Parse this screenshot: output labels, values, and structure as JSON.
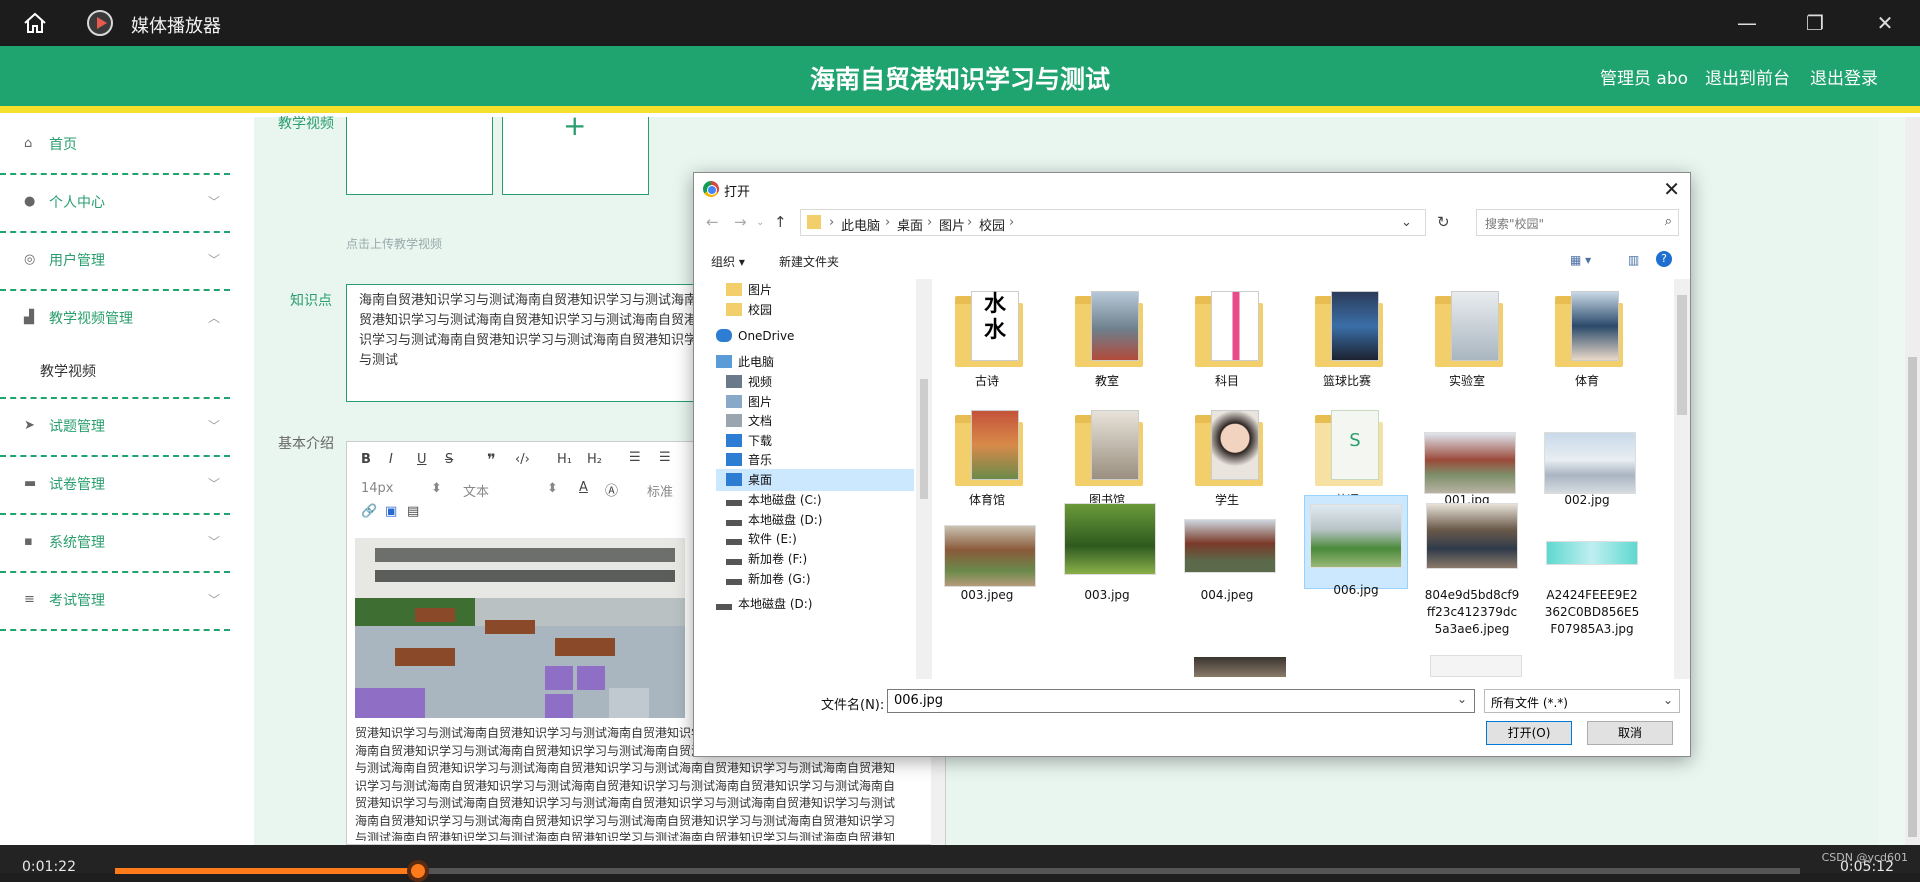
{
  "player": {
    "title": "媒体播放器",
    "time_current": "0:01:22",
    "time_total": "0:05:12",
    "progress": 0.18,
    "watermark": "CSDN @ycd601"
  },
  "site": {
    "title": "海南自贸港知识学习与测试",
    "admin": "管理员 abo",
    "front": "退出到前台",
    "logout": "退出登录"
  },
  "sidebar": {
    "items": [
      {
        "label": "首页",
        "icon": "home-icon"
      },
      {
        "label": "个人中心",
        "icon": "user-icon"
      },
      {
        "label": "用户管理",
        "icon": "settings-icon"
      },
      {
        "label": "教学视频管理",
        "icon": "chart-icon"
      },
      {
        "label": "试题管理",
        "icon": "send-icon"
      },
      {
        "label": "试卷管理",
        "icon": "monitor-icon"
      },
      {
        "label": "系统管理",
        "icon": "chat-icon"
      },
      {
        "label": "考试管理",
        "icon": "list-icon"
      }
    ],
    "sub": "教学视频"
  },
  "form": {
    "video_label": "教学视频",
    "upload_hint": "点击上传教学视频",
    "knowledge_label": "知识点",
    "knowledge_text": "海南自贸港知识学习与测试海南自贸港知识学习与测试海南自贸港知识学习与测试海南自贸港知识学习与测试海南自贸港知识学习与测试海南自贸港知识学习与测试海南自贸港知识学习与测试",
    "intro_label": "基本介绍",
    "font_size": "14px",
    "font_type": "文本",
    "heading": "标准",
    "editor_text": "贸港知识学习与测试海南自贸港知识学习与测试海南自贸港知识学习与测试海南自贸港知识学习与测试海南自贸港知识学习与测试海南自贸港知识学习与测试海南自贸港知识学习与测试海南自贸港知识学习与测试海南自贸港知识学习与测试海南自贸港知识学习与测试海南自贸港知识学习与测试海南自贸港知识学习与测试海南自贸港知识学习与测试海南自贸港知识学习与测试海南自贸港知识学习与测试海南自贸港知识学习与测试海南自贸港知识学习与测试海南自贸港知识学习与测试海南自贸港知识学习与测试海南自贸港知识学习与测试海南自贸港知识学习与测试海南自贸港知识学习与测试海南自贸港知识学习与测试海南自贸港知识学习与测试海南自贸港知识学习与测试海南自贸港知识学习与测试海南自贸港知识学习与测试"
  },
  "dialog": {
    "title": "打开",
    "path": [
      "此电脑",
      "桌面",
      "图片",
      "校园"
    ],
    "search_placeholder": "搜索\"校园\"",
    "organize": "组织 ▾",
    "new_folder": "新建文件夹",
    "tree": [
      "图片",
      "校园",
      "OneDrive",
      "此电脑",
      "视频",
      "图片",
      "文档",
      "下载",
      "音乐",
      "桌面",
      "本地磁盘 (C:)",
      "本地磁盘 (D:)",
      "软件 (E:)",
      "新加卷 (F:)",
      "新加卷 (G:)",
      "本地磁盘 (D:)"
    ],
    "files": [
      "古诗",
      "教室",
      "科目",
      "篮球比赛",
      "实验室",
      "体育",
      "体育馆",
      "图书馆",
      "学生",
      "英语",
      "001.jpg",
      "002.jpg",
      "003.jpeg",
      "003.jpg",
      "004.jpeg",
      "006.jpg",
      "804e9d5bd8cf9ff23c412379dc5a3ae6.jpeg",
      "A2424FEEE9E2362C0BD856E5F07985A3.jpg"
    ],
    "filename_label": "文件名(N):",
    "filename_value": "006.jpg",
    "filetype": "所有文件 (*.*)",
    "open_btn": "打开(O)",
    "cancel_btn": "取消"
  }
}
